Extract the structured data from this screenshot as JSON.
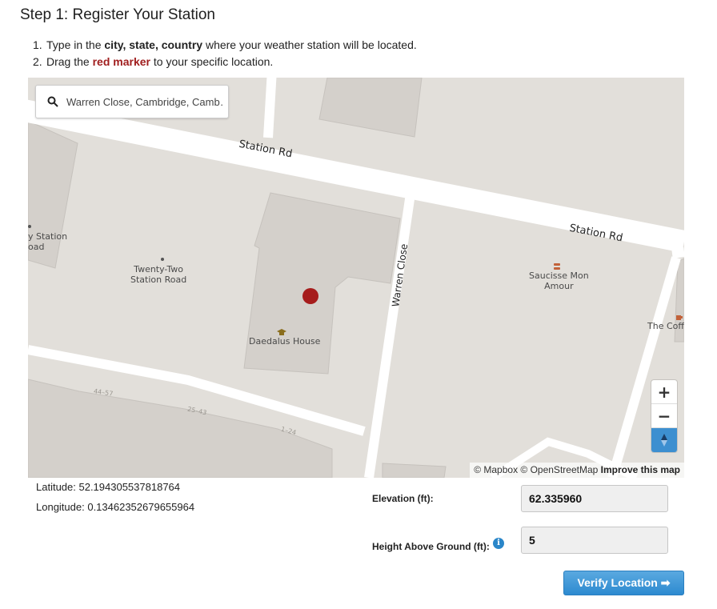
{
  "page": {
    "title": "Step 1: Register Your Station"
  },
  "instructions": {
    "step1_num": "1.",
    "step1_pre": "Type in the ",
    "step1_bold": "city, state, country",
    "step1_post": " where your weather station will be located.",
    "step2_num": "2.",
    "step2_pre": "Drag the ",
    "step2_red": "red marker",
    "step2_post": " to your specific location."
  },
  "map": {
    "search_value": "Warren Close, Cambridge, Camb…",
    "labels": {
      "station_rd_1": "Station Rd",
      "station_rd_2": "Station Rd",
      "warren_close": "Warren Close",
      "twenty_two_line1": "Twenty-Two",
      "twenty_two_line2": "Station Road",
      "daedalus": "Daedalus House",
      "saucisse_line1": "Saucisse Mon",
      "saucisse_line2": "Amour",
      "coffee": "The Coffe",
      "left_station": "y Station",
      "left_road": "oad",
      "num_44_57": "44–57",
      "num_25_43": "25–43",
      "num_1_24": "1–24"
    },
    "zoom_in": "+",
    "zoom_out": "−",
    "attribution": "© Mapbox © OpenStreetMap",
    "improve": "Improve this map",
    "colors": {
      "land": "#e2dfda",
      "building": "#d4d0cb",
      "road": "#ffffff",
      "marker": "#a61c1c"
    }
  },
  "location": {
    "latitude_text": "Latitude: 52.194305537818764",
    "longitude_text": "Longitude: 0.13462352679655964"
  },
  "form": {
    "elevation_label": "Elevation (ft):",
    "elevation_value": "62.335960",
    "height_label": "Height Above Ground (ft):",
    "height_value": "5",
    "info_icon": "i",
    "verify_label": "Verify Location ➡"
  }
}
